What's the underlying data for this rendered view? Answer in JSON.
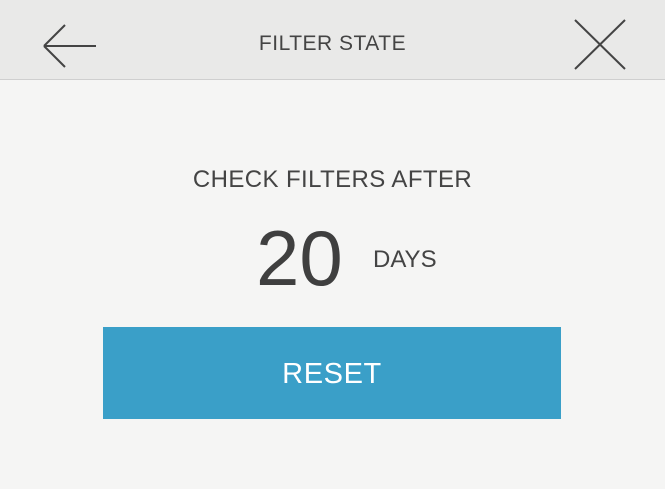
{
  "header": {
    "title": "FILTER STATE",
    "back_icon": "arrow-left-icon",
    "close_icon": "close-icon"
  },
  "main": {
    "check_label": "CHECK FILTERS AFTER",
    "days_value": "20",
    "days_unit": "DAYS",
    "reset_label": "RESET"
  },
  "colors": {
    "background": "#f5f5f4",
    "header_background": "#e9e9e8",
    "accent": "#3a9fc8",
    "text": "#444444"
  }
}
